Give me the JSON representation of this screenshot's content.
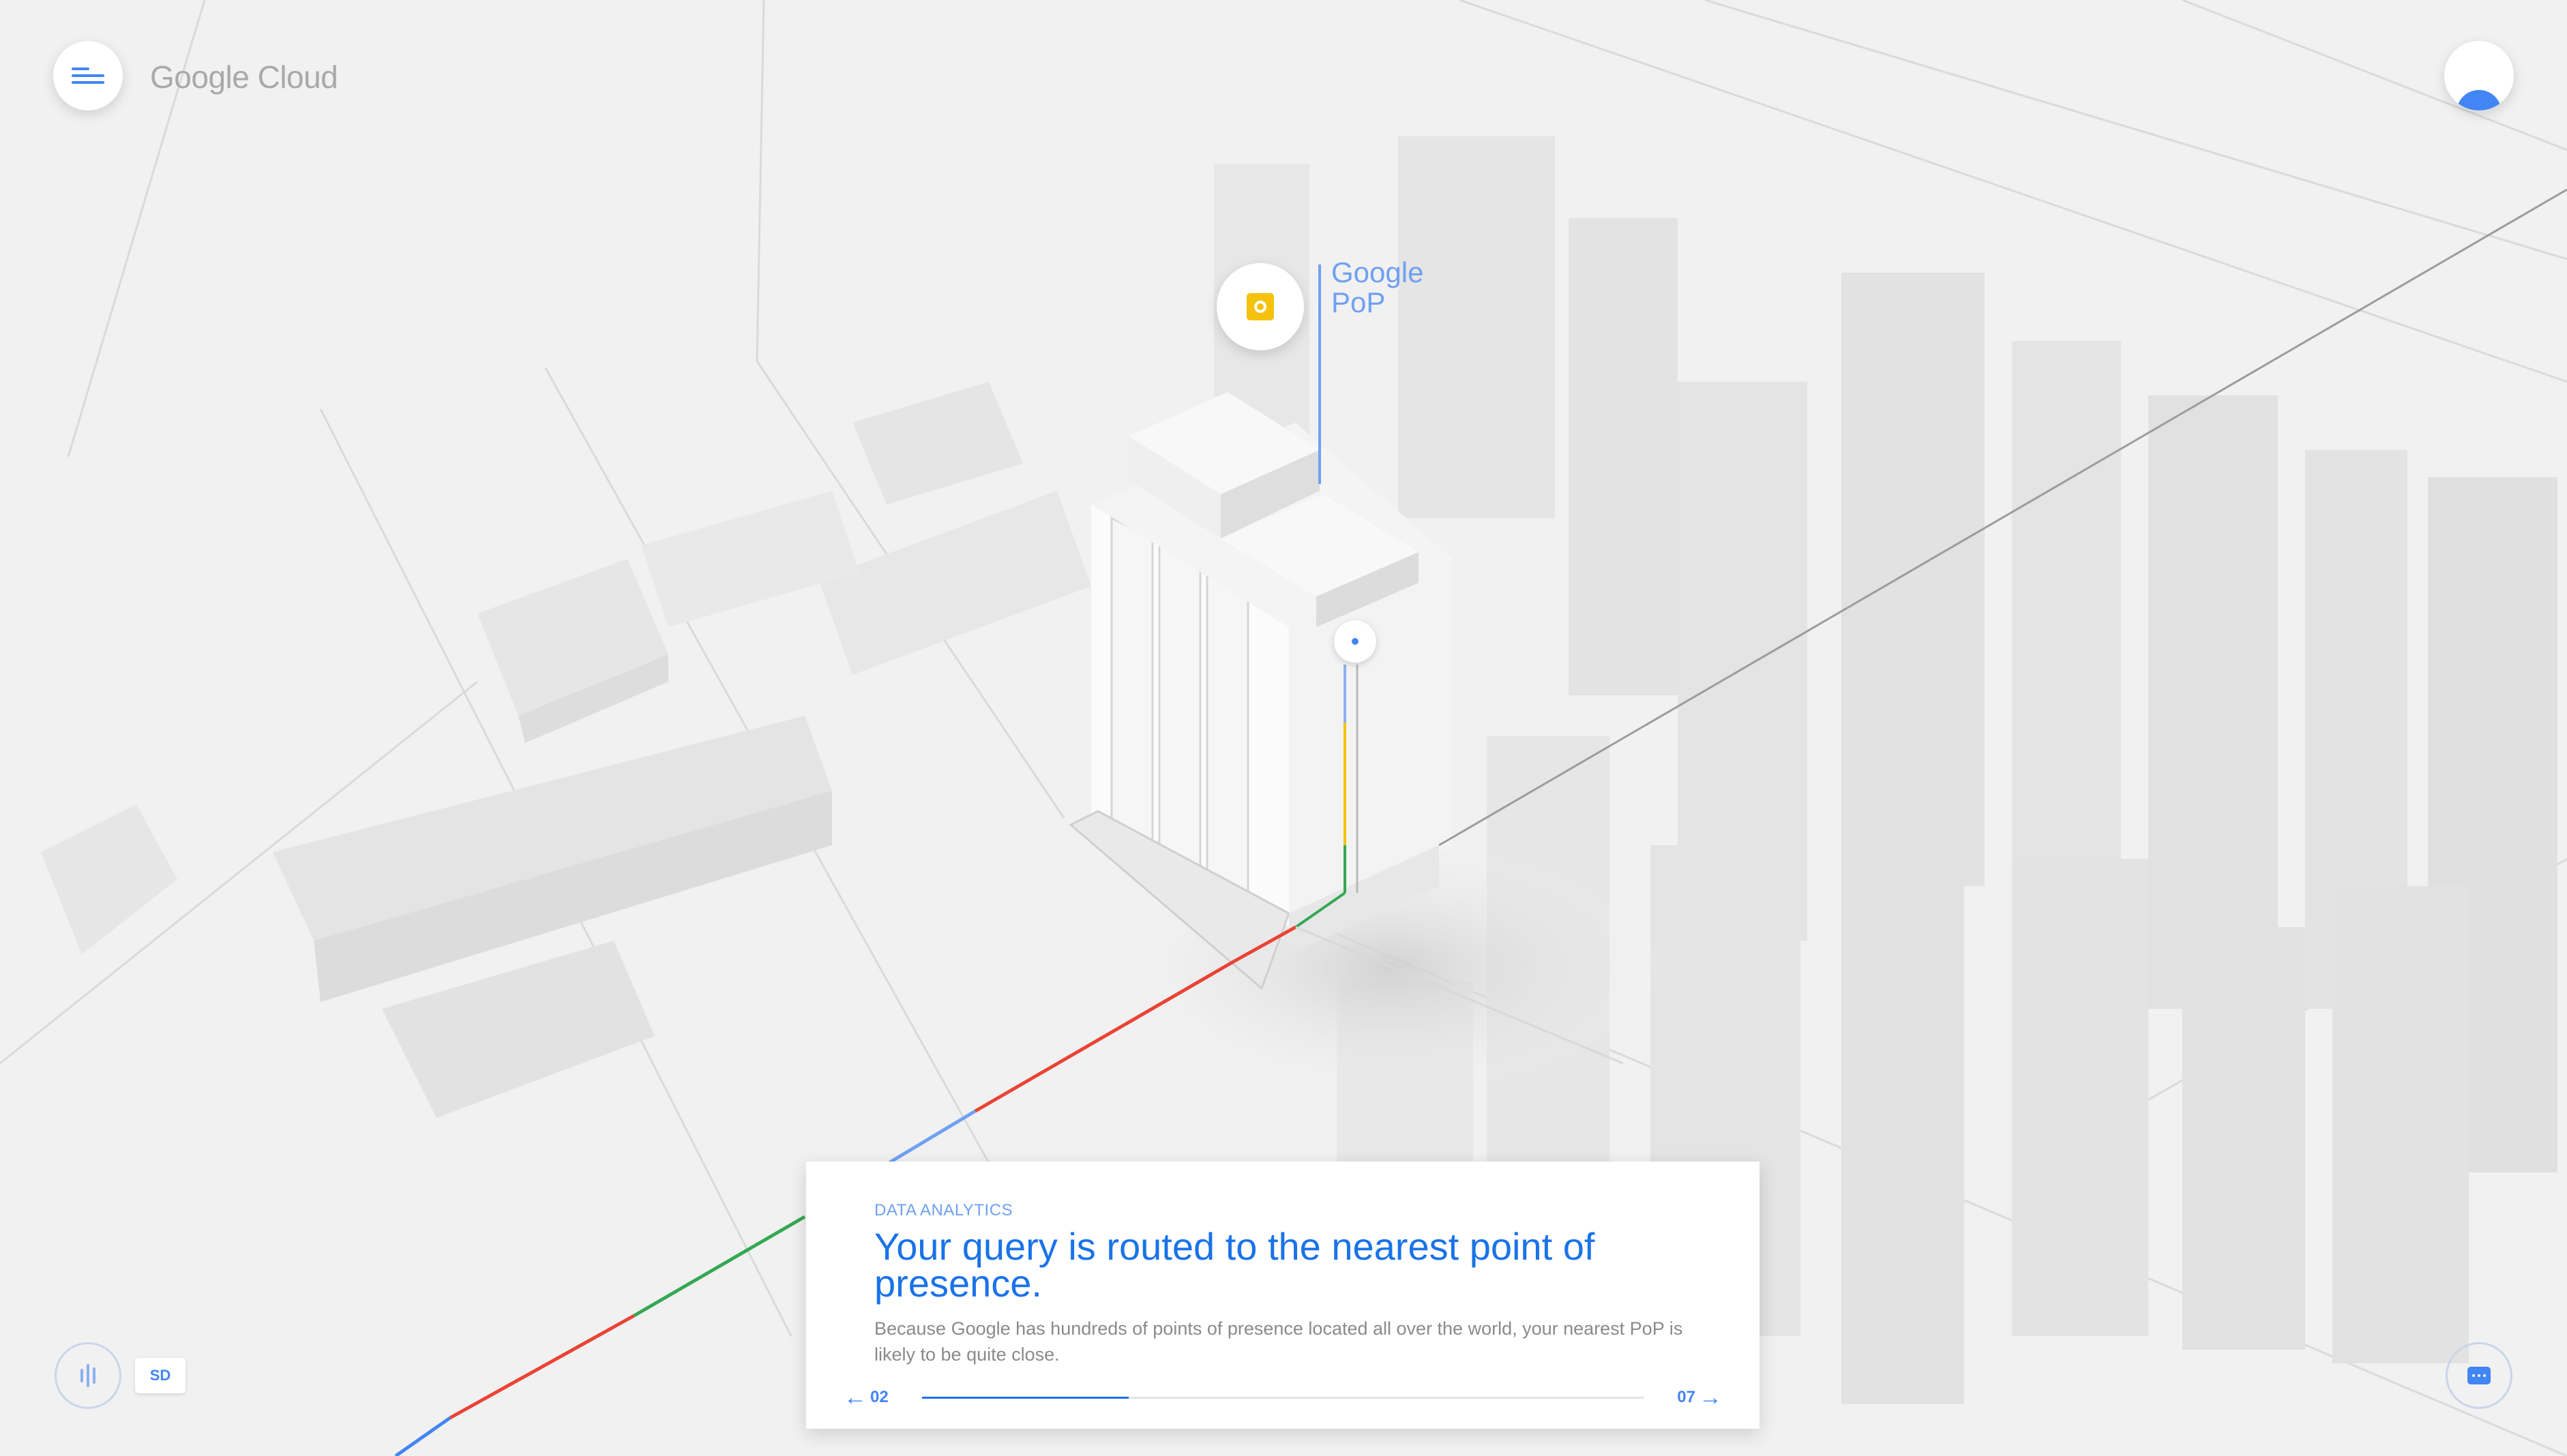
{
  "header": {
    "brand": "Google Cloud"
  },
  "scene": {
    "pop_label_line1": "Google",
    "pop_label_line2": "PoP"
  },
  "controls": {
    "quality_label": "SD"
  },
  "card": {
    "eyebrow": "DATA ANALYTICS",
    "title": "Your query is routed to the nearest point of presence.",
    "body": "Because Google has hundreds of points of presence located all over the world, your nearest PoP is likely to be quite close.",
    "current_step": "02",
    "total_steps": "07",
    "progress_fraction": 0.286
  },
  "icons": {
    "menu": "menu-icon",
    "profile": "profile-icon",
    "pop": "pop-icon",
    "audio": "audio-waveform-icon",
    "chat": "chat-icon",
    "prev": "arrow-left-icon",
    "next": "arrow-right-icon"
  },
  "colors": {
    "accent": "#4285f4",
    "title_blue": "#1a73e8",
    "google_yellow": "#f4c20d",
    "google_green": "#34a853",
    "google_red": "#ea4335"
  }
}
